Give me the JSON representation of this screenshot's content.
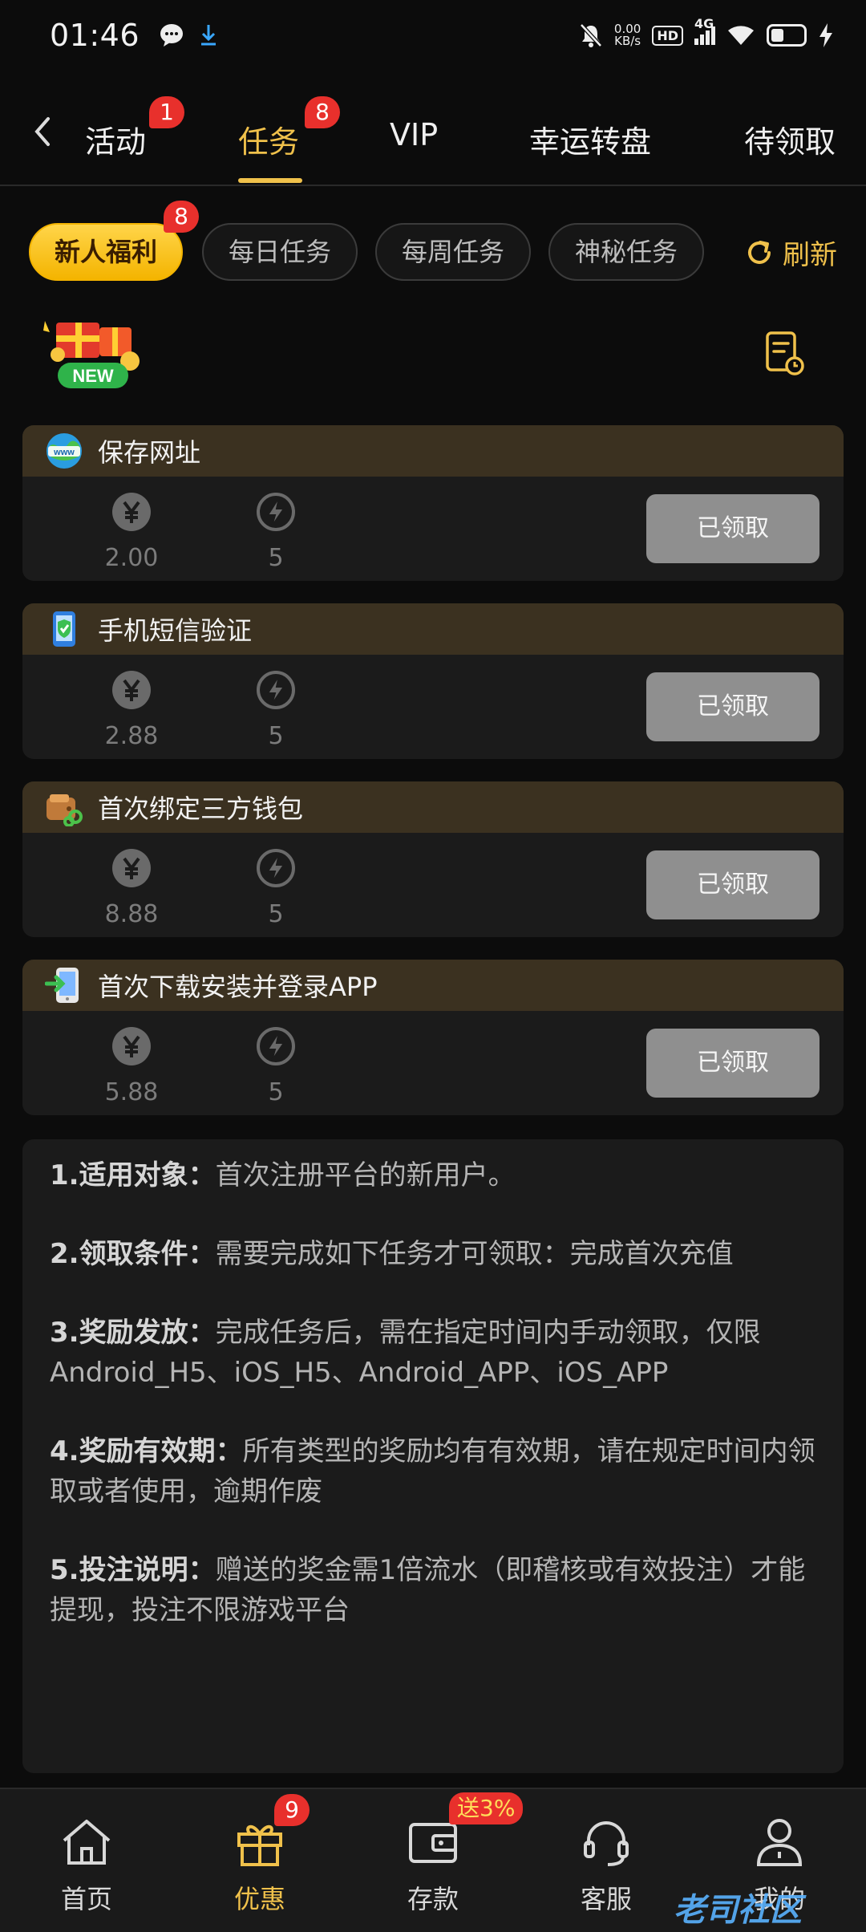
{
  "status_bar": {
    "time": "01:46",
    "net_speed_value": "0.00",
    "net_speed_unit": "KB/s",
    "hd": "HD",
    "network": "4G",
    "battery_level": 0.35
  },
  "top_tabs": [
    {
      "label": "活动",
      "badge": "1"
    },
    {
      "label": "任务",
      "badge": "8"
    },
    {
      "label": "VIP",
      "badge": ""
    },
    {
      "label": "幸运转盘",
      "badge": ""
    },
    {
      "label": "待领取",
      "badge": ""
    }
  ],
  "sub_tabs": [
    {
      "label": "新人福利",
      "badge": "8"
    },
    {
      "label": "每日任务"
    },
    {
      "label": "每周任务"
    },
    {
      "label": "神秘任务"
    }
  ],
  "refresh_label": "刷新",
  "new_badge": "NEW",
  "tasks": [
    {
      "title": "保存网址",
      "icon": "www-globe-icon",
      "money": "2.00",
      "points": "5",
      "button": "已领取"
    },
    {
      "title": "手机短信验证",
      "icon": "phone-shield-icon",
      "money": "2.88",
      "points": "5",
      "button": "已领取"
    },
    {
      "title": "首次绑定三方钱包",
      "icon": "wallet-link-icon",
      "money": "8.88",
      "points": "5",
      "button": "已领取"
    },
    {
      "title": "首次下载安装并登录APP",
      "icon": "phone-download-icon",
      "money": "5.88",
      "points": "5",
      "button": "已领取"
    }
  ],
  "rules": [
    {
      "head": "1.适用对象：",
      "body": "首次注册平台的新用户。"
    },
    {
      "head": "2.领取条件：",
      "body": "需要完成如下任务才可领取：完成首次充值"
    },
    {
      "head": "3.奖励发放：",
      "body": "完成任务后，需在指定时间内手动领取，仅限Android_H5、iOS_H5、Android_APP、iOS_APP"
    },
    {
      "head": "4.奖励有效期：",
      "body": "所有类型的奖励均有有效期，请在规定时间内领取或者使用，逾期作废"
    },
    {
      "head": "5.投注说明：",
      "body": "赠送的奖金需1倍流水（即稽核或有效投注）才能提现，投注不限游戏平台"
    }
  ],
  "bottom_nav": [
    {
      "label": "首页",
      "badge": ""
    },
    {
      "label": "优惠",
      "badge": "9"
    },
    {
      "label": "存款",
      "badge": "送3%"
    },
    {
      "label": "客服",
      "badge": ""
    },
    {
      "label": "我的",
      "badge": ""
    }
  ],
  "watermark": "老司社区",
  "colors": {
    "accent": "#f0c14b",
    "badge": "#e8302c",
    "card_head": "#3b3120",
    "claimed_button": "#8f8f8f"
  }
}
